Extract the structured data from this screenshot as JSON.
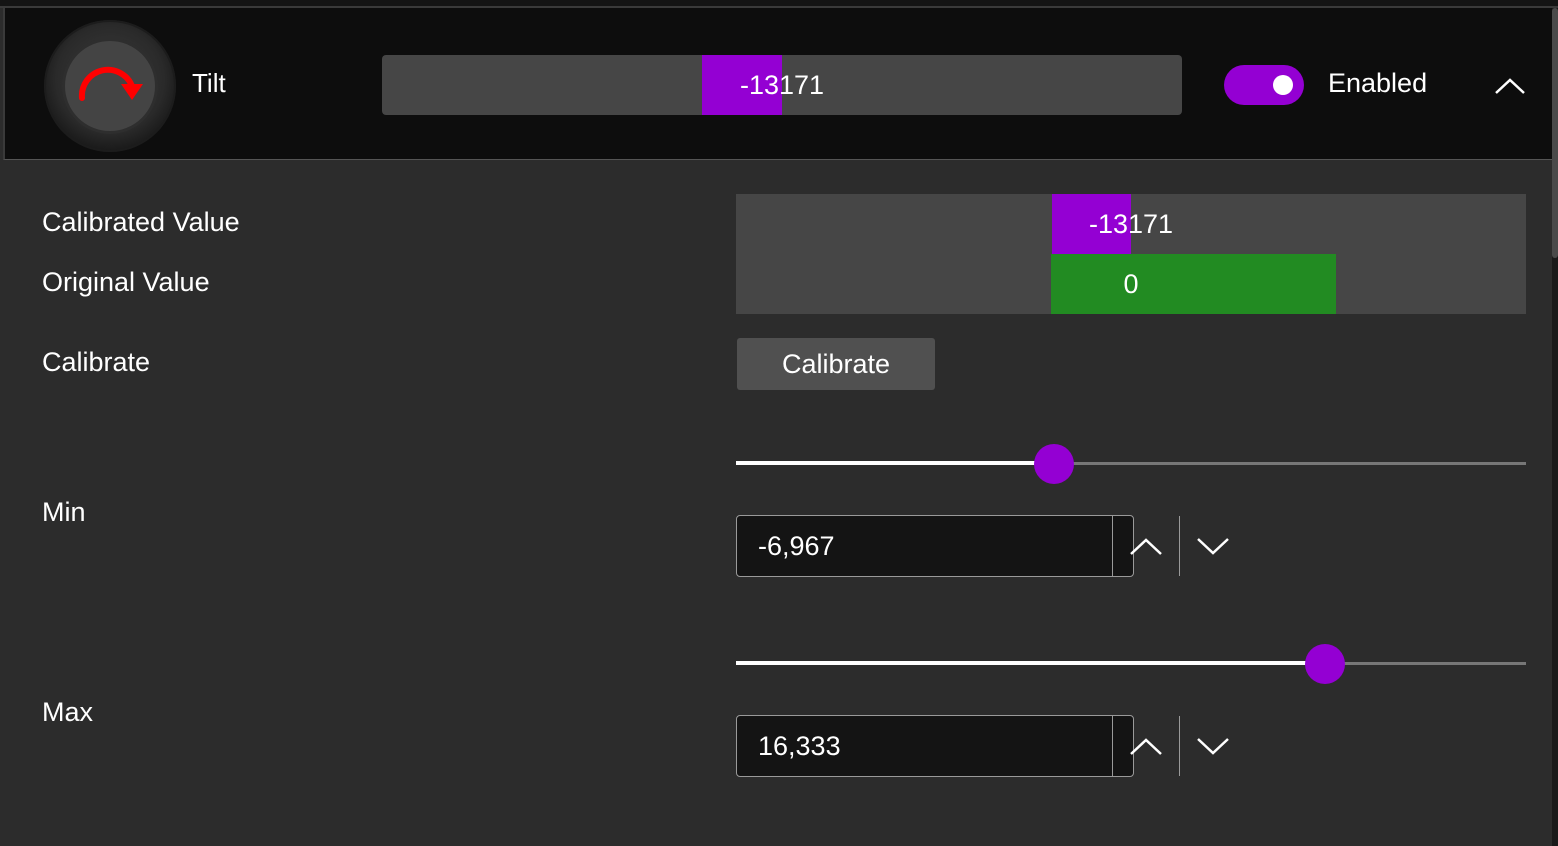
{
  "header": {
    "title": "Tilt",
    "value_text": "-13171",
    "value_fraction": -0.201,
    "toggle_label": "Enabled",
    "toggle_on": true
  },
  "rows": {
    "calibrated_label": "Calibrated Value",
    "calibrated_value": "-13171",
    "original_label": "Original Value",
    "original_value": "0",
    "calibrate_label": "Calibrate",
    "calibrate_button": "Calibrate",
    "min_label": "Min",
    "min_value": "-6,967",
    "min_slider_fraction": 0.403,
    "max_label": "Max",
    "max_value": "16,333",
    "max_slider_fraction": 0.745
  },
  "colors": {
    "accent": "#9400d3",
    "original_bar": "#228b22",
    "icon_arrow": "#ff0000"
  },
  "icons": {
    "knob": "rotate-arrow-icon",
    "collapse": "chevron-up-icon",
    "increment": "chevron-up-icon",
    "decrement": "chevron-down-icon"
  }
}
